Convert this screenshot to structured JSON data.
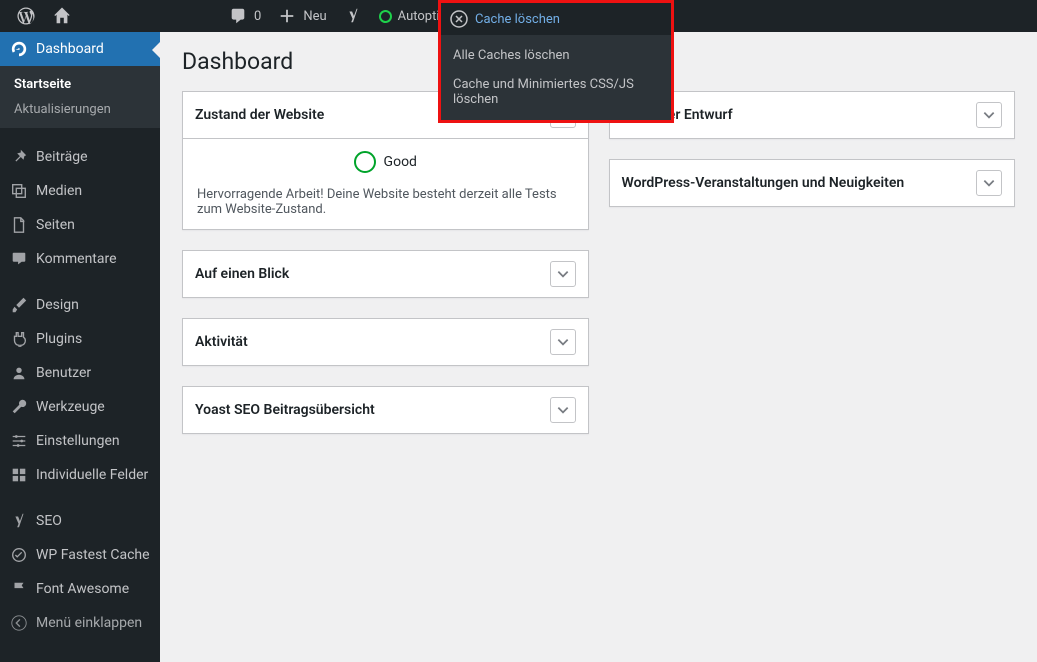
{
  "adminbar": {
    "comments_count": "0",
    "new_label": "Neu",
    "autoptimize_label": "Autoptimize",
    "cache_label": "Cache löschen",
    "cache_items": [
      "Alle Caches löschen",
      "Cache und Minimiertes CSS/JS löschen"
    ]
  },
  "sidebar": {
    "dashboard": "Dashboard",
    "sub": {
      "home": "Startseite",
      "updates": "Aktualisierungen"
    },
    "items": [
      "Beiträge",
      "Medien",
      "Seiten",
      "Kommentare"
    ],
    "items2": [
      "Design",
      "Plugins",
      "Benutzer",
      "Werkzeuge",
      "Einstellungen",
      "Individuelle Felder"
    ],
    "items3": [
      "SEO",
      "WP Fastest Cache",
      "Font Awesome"
    ],
    "collapse": "Menü einklappen"
  },
  "page": {
    "title": "Dashboard"
  },
  "boxes": {
    "health": {
      "title": "Zustand der Website",
      "status": "Good",
      "body": "Hervorragende Arbeit! Deine Website besteht derzeit alle Tests zum Website-Zustand."
    },
    "glance": {
      "title": "Auf einen Blick"
    },
    "activity": {
      "title": "Aktivität"
    },
    "yoast": {
      "title": "Yoast SEO Beitragsübersicht"
    },
    "draft": {
      "title": "Schneller Entwurf"
    },
    "events": {
      "title": "WordPress-Veranstaltungen und Neuigkeiten"
    }
  }
}
